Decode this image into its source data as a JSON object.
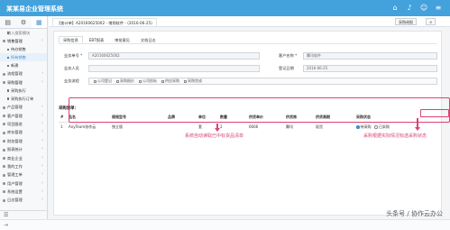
{
  "app": {
    "title": "某某易企业管理系统",
    "top_icons": [
      "home-icon",
      "bell-icon",
      "user-icon",
      "menu-icon"
    ]
  },
  "sidebar": {
    "tools": [
      "▤",
      "⚙",
      "▦"
    ],
    "groups": [
      {
        "label": "输入搜索模块",
        "type": "search"
      },
      {
        "label": "销售管理",
        "type": "group",
        "open": true
      },
      {
        "label": "待办销售",
        "type": "sub"
      },
      {
        "label": "所有销售",
        "type": "sub",
        "active": true
      },
      {
        "label": "新建",
        "type": "sub"
      },
      {
        "label": "流程管理",
        "type": "group"
      },
      {
        "label": "采购管理",
        "type": "group",
        "open": true
      },
      {
        "label": "采购执行",
        "type": "sub"
      },
      {
        "label": "采购执行订单",
        "type": "sub"
      },
      {
        "label": "产品管理",
        "type": "group"
      },
      {
        "label": "客户管理",
        "type": "group"
      },
      {
        "label": "项目跟进",
        "type": "group"
      },
      {
        "label": "库存管理",
        "type": "group"
      },
      {
        "label": "财务管理",
        "type": "group"
      },
      {
        "label": "报表统计",
        "type": "group"
      },
      {
        "label": "商业企业",
        "type": "group"
      },
      {
        "label": "我的工作",
        "type": "group"
      },
      {
        "label": "管理工单",
        "type": "group"
      },
      {
        "label": "用户管理",
        "type": "group"
      },
      {
        "label": "系统设置",
        "type": "group"
      },
      {
        "label": "日志管理",
        "type": "group"
      }
    ],
    "bottom_icon": "list-icon"
  },
  "tabbar": {
    "tab_label": "【查计单】A20160625002 - 增销软件 - (2016-06-25)",
    "buttons": [
      "采购询报",
      "×"
    ]
  },
  "subtabs": [
    "采购信息",
    "EBT报表",
    "审批意见",
    "文档日志"
  ],
  "form": {
    "order_no_label": "业务单号 *",
    "order_no_value": "A20160625002",
    "customer_label": "客户名称 *",
    "customer_value": "腾讯软件",
    "staff_label": "业务人员",
    "staff_value": "",
    "date_label": "登记日期",
    "date_value": "2016-06-25",
    "flow_label": "业务流程",
    "flow_items": [
      "公司登记",
      "采购报价",
      "公司投标",
      "供应采购",
      "采购完成"
    ]
  },
  "section_title": "采购清单：",
  "table": {
    "headers": [
      "#",
      "品名",
      "规格型号",
      "品牌",
      "单位",
      "数量",
      "供货单价",
      "供货商",
      "供货周期",
      "采购状态"
    ],
    "rows": [
      {
        "no": "1",
        "name": "AnyTeam协作云",
        "model": "独立版",
        "brand": "",
        "unit": "套",
        "qty": "2",
        "price": "6666",
        "supplier": "腾讯",
        "period": "现货",
        "status_options": [
          "待采购",
          "已采购"
        ],
        "status_selected": 0
      }
    ]
  },
  "annotations": {
    "left": "系统自动读取已中标货品清单",
    "right": "采购根据实际情况标选采购状态"
  },
  "watermark": "头条号 / 协作云办公"
}
